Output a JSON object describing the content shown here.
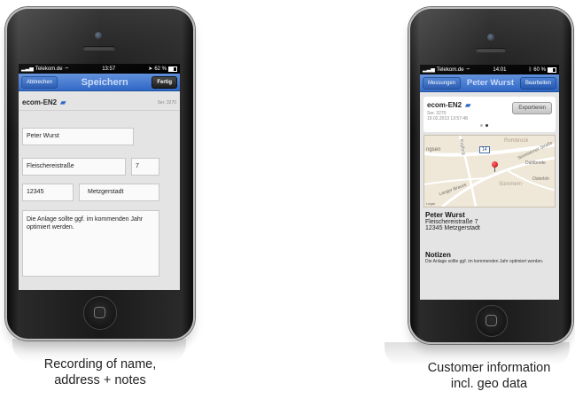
{
  "left_phone": {
    "status": {
      "carrier": "Telekom.de",
      "time": "13:57",
      "battery": "62 %"
    },
    "nav": {
      "cancel_label": "Abbrechen",
      "title": "Speichern",
      "done_label": "Fertig"
    },
    "device": {
      "name": "ecom-EN2",
      "serial": "Ser. 3270"
    },
    "form": {
      "name": "Peter Wurst",
      "street": "Fleischereistraße",
      "house_number": "7",
      "zip": "12345",
      "city": "Metzgerstadt",
      "notes": "Die Anlage sollte ggf. im kommenden Jahr optimiert werden."
    }
  },
  "right_phone": {
    "status": {
      "carrier": "Telekom.de",
      "time": "14:01",
      "battery": "60 %"
    },
    "nav": {
      "back_label": "Messungen",
      "title": "Peter Wurst",
      "edit_label": "Bearbeiten"
    },
    "device": {
      "name": "ecom-EN2",
      "serial": "Ser. 3270",
      "date": "19.02.2013 13:57:48",
      "export_label": "Exportieren"
    },
    "map": {
      "labels": [
        "Rombrock",
        "ngsen",
        "Sümmerner Straße",
        "Dahlbreite",
        "Sümmern",
        "Osterloh",
        "Langer Brauck",
        "Kupferg"
      ],
      "road_number": "14",
      "legal": "Legal"
    },
    "customer": {
      "name": "Peter Wurst",
      "street": "Fleischereistraße 7",
      "city_line": "12345 Metzgerstadt"
    },
    "notes": {
      "title": "Notizen",
      "text": "Die Anlage sollte ggf. im kommenden Jahr optimiert werden."
    }
  },
  "captions": {
    "left": [
      "Recording of name,",
      "address + notes"
    ],
    "right": [
      "Customer information",
      "incl. geo data"
    ]
  },
  "colors": {
    "nav_blue": "#2f67c6",
    "pin_red": "#d20000",
    "map_bg": "#efe8d8"
  }
}
